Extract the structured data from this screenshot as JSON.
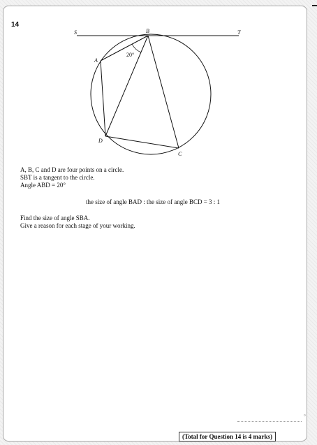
{
  "question": {
    "number": "14"
  },
  "figure": {
    "points": {
      "S": "S",
      "B": "B",
      "T": "T",
      "A": "A",
      "D": "D",
      "C": "C"
    },
    "angle_label": "20°"
  },
  "statements": [
    "A, B, C and D are four points on a circle.",
    "SBT is a tangent to the circle.",
    "Angle ABD = 20°"
  ],
  "ratio": "the size of angle BAD : the size of angle BCD = 3 : 1",
  "instructions": [
    "Find the size of angle SBA.",
    "Give a reason for each stage of your working."
  ],
  "answer_marker": "°",
  "total": "(Total for Question 14 is 4 marks)"
}
